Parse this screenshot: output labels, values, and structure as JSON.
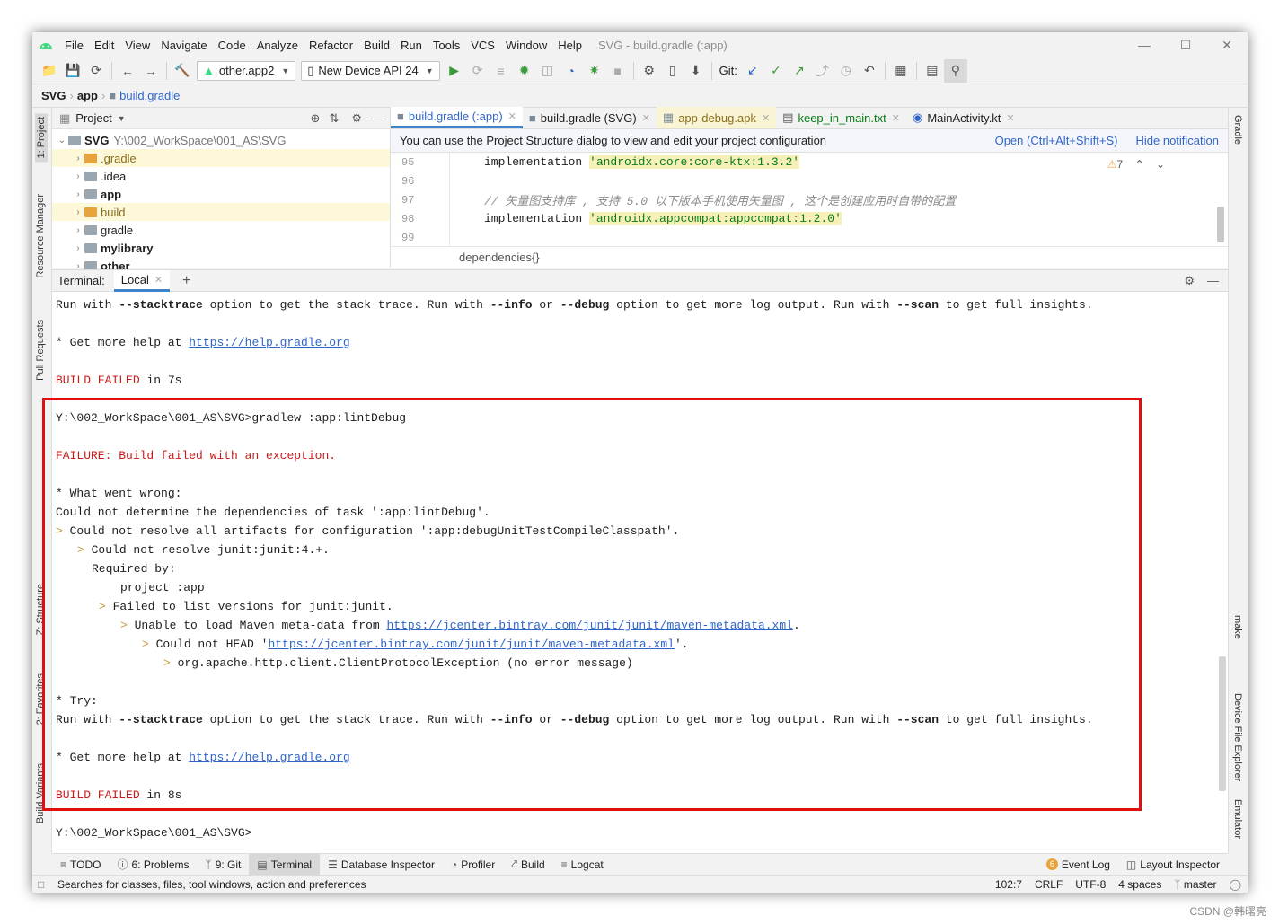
{
  "menubar": {
    "items": [
      "File",
      "Edit",
      "View",
      "Navigate",
      "Code",
      "Analyze",
      "Refactor",
      "Build",
      "Run",
      "Tools",
      "VCS",
      "Window",
      "Help"
    ],
    "window_title": "SVG - build.gradle (:app)"
  },
  "toolbar": {
    "module_combo": "other.app2",
    "device_combo": "New Device API 24",
    "git_label": "Git:"
  },
  "breadcrumb": [
    "SVG",
    "app",
    "build.gradle"
  ],
  "left_stripe": {
    "tabs": [
      "1: Project",
      "Resource Manager",
      "Pull Requests",
      "Z: Structure",
      "2: Favorites",
      "Build Variants"
    ]
  },
  "right_stripe": {
    "tabs": [
      "Gradle",
      "make",
      "Device File Explorer",
      "Emulator"
    ]
  },
  "project_panel": {
    "title": "Project",
    "root_name": "SVG",
    "root_path": "Y:\\002_WorkSpace\\001_AS\\SVG",
    "items": [
      ".gradle",
      ".idea",
      "app",
      "build",
      "gradle",
      "mylibrary",
      "other"
    ]
  },
  "editor": {
    "tabs": [
      "build.gradle (:app)",
      "build.gradle (SVG)",
      "app-debug.apk",
      "keep_in_main.txt",
      "MainActivity.kt"
    ],
    "notice": "You can use the Project Structure dialog to view and edit your project configuration",
    "notice_open": "Open (Ctrl+Alt+Shift+S)",
    "notice_hide": "Hide notification",
    "warnings": "7",
    "lines": {
      "n95": "95",
      "n96": "96",
      "n97": "97",
      "n98": "98",
      "n99": "99",
      "l95_kw": "implementation ",
      "l95_str": "'androidx.core:core-ktx:1.3.2'",
      "l97_cmt": "// 矢量图支持库 , 支持 5.0 以下版本手机使用矢量图 , 这个是创建应用时自带的配置",
      "l98_kw": "implementation ",
      "l98_str": "'androidx.appcompat:appcompat:1.2.0'"
    },
    "footer_crumb": "dependencies{}"
  },
  "terminal": {
    "label": "Terminal:",
    "tab": "Local",
    "l_run1_a": "Run with ",
    "l_run1_b": "--stacktrace",
    "l_run1_c": " option to get the stack trace. Run with ",
    "l_run1_d": "--info",
    "l_run1_e": " or ",
    "l_run1_f": "--debug",
    "l_run1_g": " option to get more log output. Run with ",
    "l_run1_h": "--scan",
    "l_run1_i": " to get full insights.",
    "l_help1_a": "* Get more help at ",
    "l_help1_link": "https://help.gradle.org",
    "l_fail1_a": "BUILD FAILED",
    "l_fail1_b": " in 7s",
    "l_prompt1": "Y:\\002_WorkSpace\\001_AS\\SVG>gradlew :app:lintDebug",
    "l_failure": "FAILURE: Build failed with an exception.",
    "l_wrong": "* What went wrong:",
    "l_could": "Could not determine the dependencies of task ':app:lintDebug'.",
    "l_res_a": "Could not resolve all artifacts for configuration ':app:debugUnitTestCompileClasspath'.",
    "l_junit": "Could not resolve junit:junit:4.+.",
    "l_req": "Required by:",
    "l_proj": "project :app",
    "l_list": "Failed to list versions for junit:junit.",
    "l_maven_a": "Unable to load Maven meta-data from ",
    "l_maven_link": "https://jcenter.bintray.com/junit/junit/maven-metadata.xml",
    "l_maven_c": ".",
    "l_head_a": "Could not HEAD '",
    "l_head_link": "https://jcenter.bintray.com/junit/junit/maven-metadata.xml",
    "l_head_c": "'.",
    "l_exc": "org.apache.http.client.ClientProtocolException (no error message)",
    "l_try": "* Try:",
    "l_fail2_b": " in 8s",
    "l_prompt2": "Y:\\002_WorkSpace\\001_AS\\SVG>",
    "gt": ">"
  },
  "bottom_tools": {
    "todo": "TODO",
    "problems": "6: Problems",
    "git": "9: Git",
    "terminal": "Terminal",
    "db": "Database Inspector",
    "profiler": "Profiler",
    "build": "Build",
    "logcat": "Logcat",
    "event_count": "6",
    "event_log": "Event Log",
    "layout_inspector": "Layout Inspector"
  },
  "status": {
    "message": "Searches for classes, files, tool windows, action and preferences",
    "position": "102:7",
    "line_sep": "CRLF",
    "encoding": "UTF-8",
    "indent": "4 spaces",
    "branch": "master"
  },
  "watermark": "CSDN @韩曙亮",
  "colors": {
    "accent": "#4083c9",
    "error_red": "#cc1a1a",
    "highlight_box": "#e01010",
    "link": "#2f65ca",
    "string_green": "#067d17"
  }
}
